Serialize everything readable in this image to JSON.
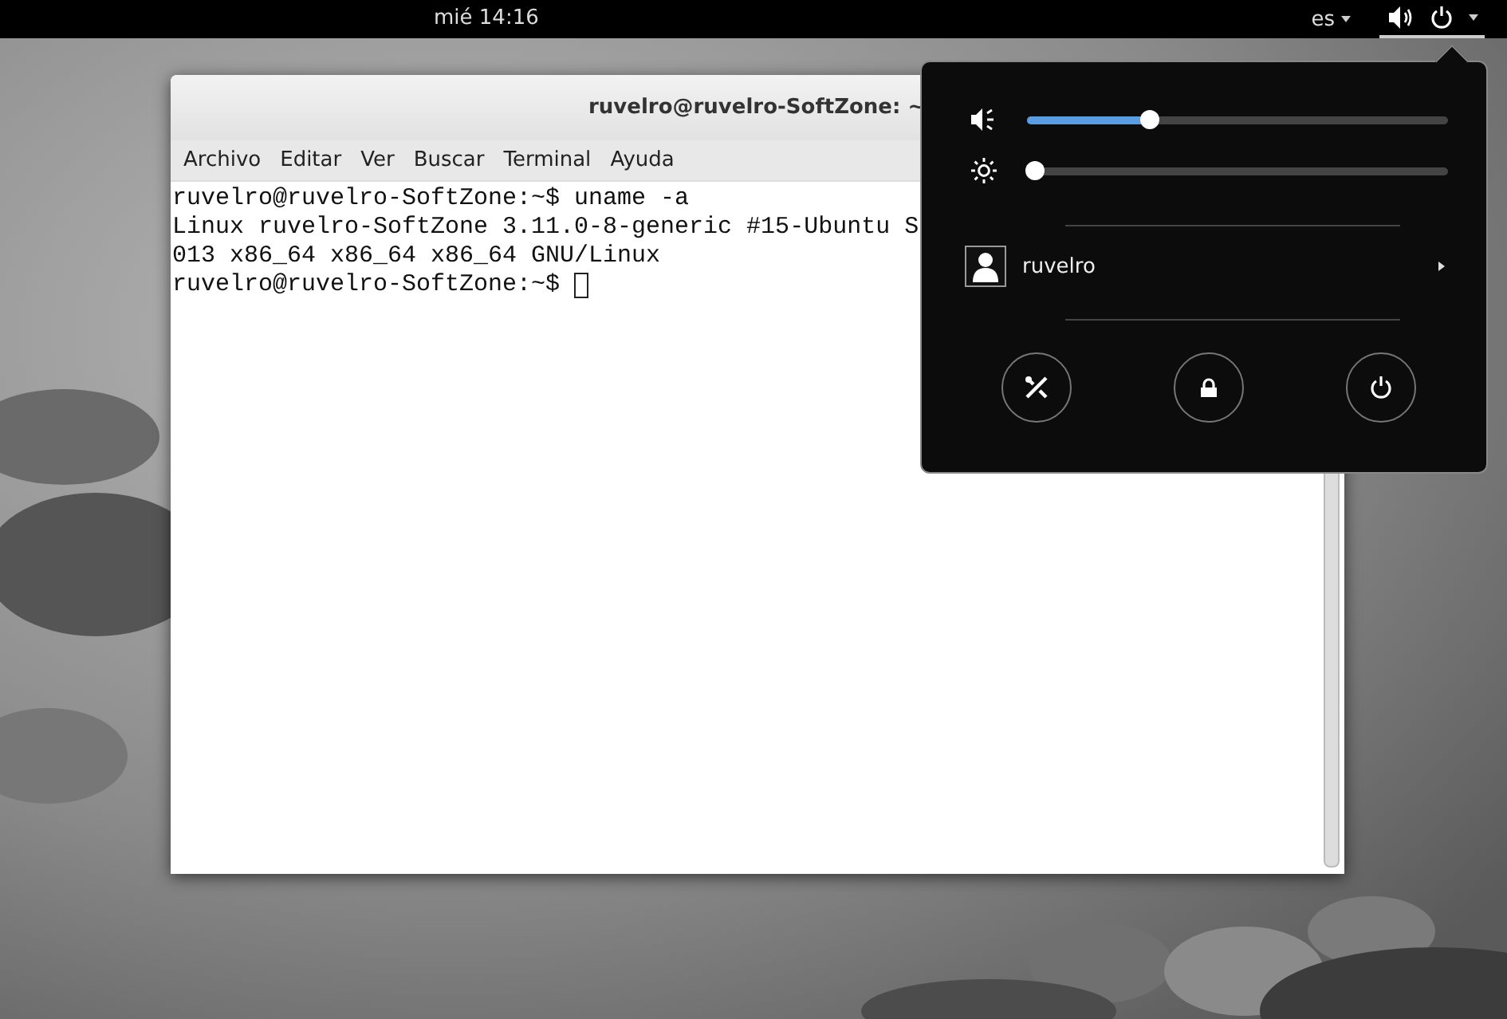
{
  "top_bar": {
    "clock": "mié 14:16",
    "keyboard_layout": "es"
  },
  "terminal": {
    "title": "ruvelro@ruvelro-SoftZone: ~",
    "menu": [
      "Archivo",
      "Editar",
      "Ver",
      "Buscar",
      "Terminal",
      "Ayuda"
    ],
    "lines": [
      "ruvelro@ruvelro-SoftZone:~$ uname -a",
      "Linux ruvelro-SoftZone 3.11.0-8-generic #15-Ubuntu S",
      "013 x86_64 x86_64 x86_64 GNU/Linux",
      "ruvelro@ruvelro-SoftZone:~$ "
    ]
  },
  "system_menu": {
    "sliders": [
      {
        "kind": "volume",
        "level": 0.29
      },
      {
        "kind": "brightness",
        "level": 0.02
      }
    ],
    "user": {
      "name": "ruvelro"
    },
    "actions": [
      {
        "kind": "settings"
      },
      {
        "kind": "lock"
      },
      {
        "kind": "power"
      }
    ]
  }
}
